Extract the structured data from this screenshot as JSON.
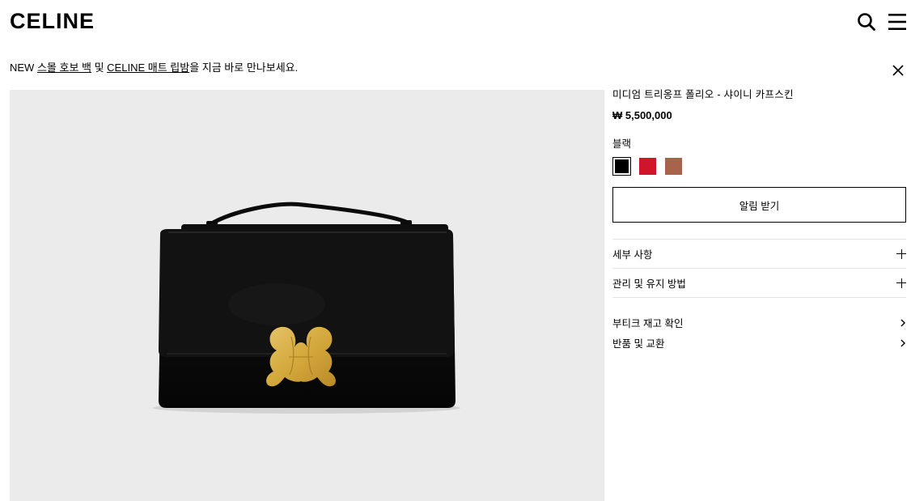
{
  "header": {
    "logo": "CELINE"
  },
  "banner": {
    "prefix": "NEW ",
    "link1": "스몰 호보 백",
    "middle": " 및 ",
    "link2": "CELINE 매트 립밤",
    "suffix": "을 지금 바로 만나보세요."
  },
  "product": {
    "name": "미디엄 트리옹프 폴리오 - 샤이니 카프스킨",
    "price": "₩ 5,500,000",
    "color_label": "블랙",
    "colors": [
      "#000000",
      "#d0142a",
      "#a8644a"
    ],
    "notify_label": "알림 받기"
  },
  "accordion": {
    "items": [
      {
        "label": "세부 사항"
      },
      {
        "label": "관리 및 유지 방법"
      }
    ]
  },
  "links": {
    "items": [
      {
        "label": "부티크 재고 확인"
      },
      {
        "label": "반품 및 교환"
      }
    ]
  }
}
